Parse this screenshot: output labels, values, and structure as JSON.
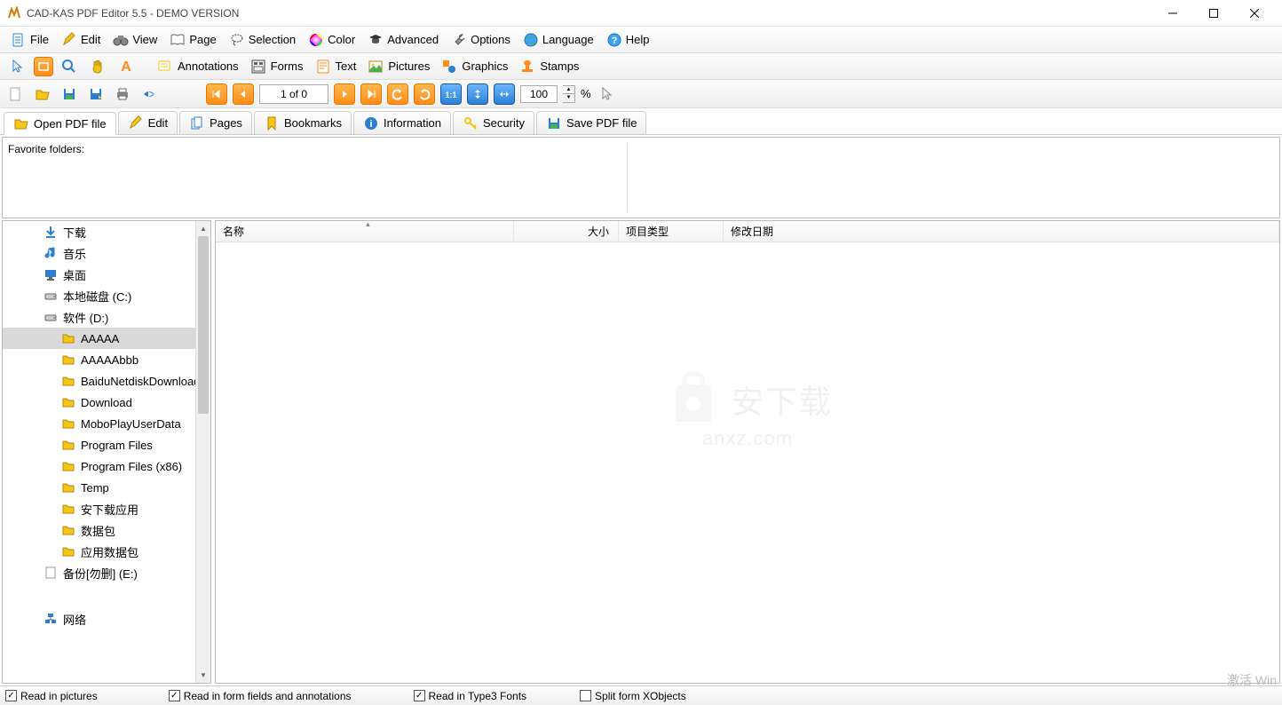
{
  "window": {
    "title": "CAD-KAS PDF Editor 5.5 - DEMO VERSION"
  },
  "menu": {
    "file": "File",
    "edit": "Edit",
    "view": "View",
    "page": "Page",
    "selection": "Selection",
    "color": "Color",
    "advanced": "Advanced",
    "options": "Options",
    "language": "Language",
    "help": "Help"
  },
  "toolbar2": {
    "annotations": "Annotations",
    "forms": "Forms",
    "text": "Text",
    "pictures": "Pictures",
    "graphics": "Graphics",
    "stamps": "Stamps"
  },
  "nav": {
    "page_display": "1 of 0",
    "zoom": "100",
    "zoom_suffix": "%"
  },
  "tabs": {
    "open": "Open PDF file",
    "edit": "Edit",
    "pages": "Pages",
    "bookmarks": "Bookmarks",
    "information": "Information",
    "security": "Security",
    "save": "Save PDF file"
  },
  "favorites": {
    "label": "Favorite folders:"
  },
  "tree": {
    "items": [
      {
        "label": "下载",
        "icon": "download",
        "level": 1
      },
      {
        "label": "音乐",
        "icon": "music",
        "level": 1
      },
      {
        "label": "桌面",
        "icon": "desktop",
        "level": 1
      },
      {
        "label": "本地磁盘 (C:)",
        "icon": "drive",
        "level": 1
      },
      {
        "label": "软件 (D:)",
        "icon": "drive",
        "level": 1
      },
      {
        "label": "AAAAA",
        "icon": "folder",
        "level": 2,
        "selected": true
      },
      {
        "label": "AAAAAbbb",
        "icon": "folder",
        "level": 2
      },
      {
        "label": "BaiduNetdiskDownload",
        "icon": "folder",
        "level": 2
      },
      {
        "label": "Download",
        "icon": "folder",
        "level": 2
      },
      {
        "label": "MoboPlayUserData",
        "icon": "folder",
        "level": 2
      },
      {
        "label": "Program Files",
        "icon": "folder",
        "level": 2
      },
      {
        "label": "Program Files (x86)",
        "icon": "folder",
        "level": 2
      },
      {
        "label": "Temp",
        "icon": "folder",
        "level": 2
      },
      {
        "label": "安下载应用",
        "icon": "folder",
        "level": 2
      },
      {
        "label": "数据包",
        "icon": "folder",
        "level": 2
      },
      {
        "label": "应用数据包",
        "icon": "folder",
        "level": 2
      },
      {
        "label": "备份[勿删] (E:)",
        "icon": "page",
        "level": 1
      }
    ],
    "network": "网络"
  },
  "columns": {
    "name": "名称",
    "size": "大小",
    "type": "项目类型",
    "date": "修改日期"
  },
  "watermark": {
    "text": "安下载",
    "url": "anxz.com"
  },
  "status": {
    "read_pictures": "Read in pictures",
    "read_forms": "Read in form fields and annotations",
    "read_type3": "Read in Type3 Fonts",
    "split_xobjects": "Split form XObjects"
  },
  "activate": "激活 Win"
}
